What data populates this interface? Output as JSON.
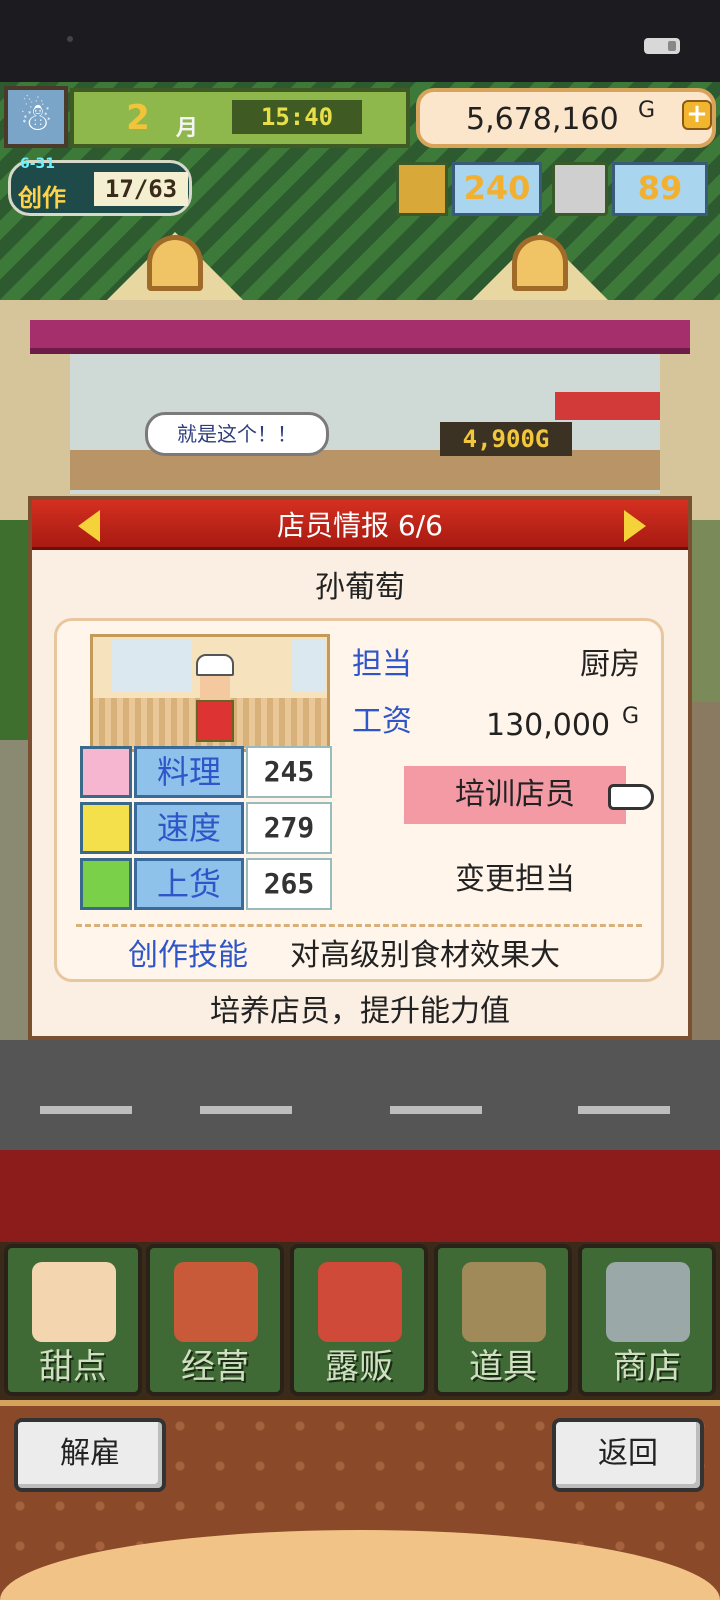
{
  "hud": {
    "month": "2",
    "month_label": "月",
    "time": "15:40",
    "money": "5,678,160",
    "money_unit": "G",
    "create": {
      "date": "6-31",
      "label": "创作",
      "count": "17/63"
    },
    "gold": "240",
    "coins": "89"
  },
  "scene": {
    "speech": "就是这个！！",
    "float_money": "4,900G"
  },
  "dialog": {
    "title": "店员情报 6/6",
    "name": "孙葡萄",
    "role_label": "担当",
    "role_value": "厨房",
    "wage_label": "工资",
    "wage_value": "130,000",
    "wage_unit": "G",
    "stats": [
      {
        "label": "料理",
        "value": "245",
        "icon": "bowl-icon"
      },
      {
        "label": "速度",
        "value": "279",
        "icon": "rocket-icon"
      },
      {
        "label": "上货",
        "value": "265",
        "icon": "drumstick-icon"
      }
    ],
    "train_button": "培训店员",
    "change_button": "变更担当",
    "skill_label": "创作技能",
    "skill_value": "对高级别食材效果大",
    "hint": "培养店员，提升能力值"
  },
  "menu": [
    {
      "label": "甜点",
      "icon": "cake-icon"
    },
    {
      "label": "经营",
      "icon": "shop-icon"
    },
    {
      "label": "露贩",
      "icon": "food-truck-icon"
    },
    {
      "label": "道具",
      "icon": "gear-bag-icon"
    },
    {
      "label": "商店",
      "icon": "cart-icon"
    }
  ],
  "bottom": {
    "fire_button": "解雇",
    "back_button": "返回"
  }
}
